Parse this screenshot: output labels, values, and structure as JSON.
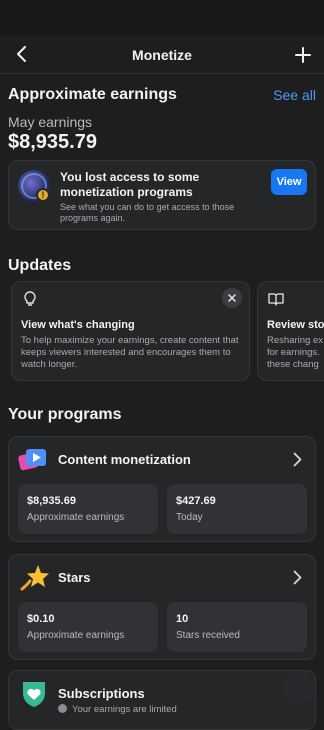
{
  "header": {
    "title": "Monetize",
    "back_icon": "chevron-left-icon",
    "add_icon": "plus-icon"
  },
  "earnings": {
    "title": "Approximate earnings",
    "see_all": "See all",
    "month_label": "May earnings",
    "amount": "$8,935.79"
  },
  "alert": {
    "title": "You lost access to some monetization programs",
    "subtitle": "See what you can do to get access to those programs again.",
    "button": "View",
    "accent": "#1877f2"
  },
  "updates": {
    "title": "Updates",
    "cards": [
      {
        "icon": "lightbulb-icon",
        "title": "View what's changing",
        "body": "To help maximize your earnings, create content that keeps viewers interested and encourages them to watch longer."
      },
      {
        "icon": "book-icon",
        "title": "Review sto",
        "body_lines": [
          "Resharing ex",
          "for earnings.",
          "these chang"
        ]
      }
    ]
  },
  "programs": {
    "title": "Your programs",
    "items": [
      {
        "name": "Content monetization",
        "icon": "content-monetization-icon",
        "stats": [
          {
            "value": "$8,935.69",
            "label": "Approximate earnings"
          },
          {
            "value": "$427.69",
            "label": "Today"
          }
        ]
      },
      {
        "name": "Stars",
        "icon": "star-icon",
        "stats": [
          {
            "value": "$0.10",
            "label": "Approximate earnings"
          },
          {
            "value": "10",
            "label": "Stars received"
          }
        ]
      },
      {
        "name": "Subscriptions",
        "icon": "subscriptions-shield-icon",
        "note": "Your earnings are limited"
      }
    ]
  }
}
